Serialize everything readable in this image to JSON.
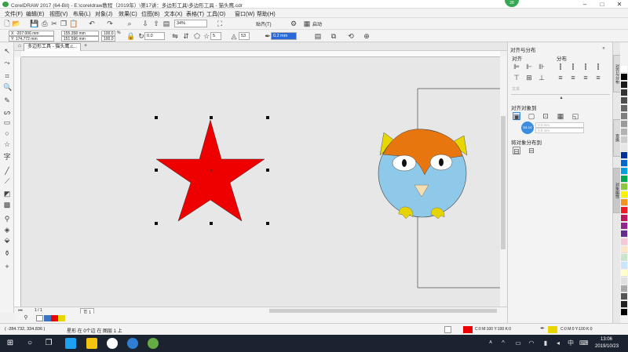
{
  "window": {
    "title": "CorelDRAW 2017 (64-Bit) - E:\\coreldraw教程（2019年）\\第17讲：多边形工具\\多边形工具 - 猫头鹰.cdr",
    "badge": "28"
  },
  "menu": [
    "文件(F)",
    "编辑(E)",
    "视图(V)",
    "布局(L)",
    "对象(J)",
    "效果(C)",
    "位图(B)",
    "文本(X)",
    "表格(T)",
    "工具(O)",
    "窗口(W)",
    "帮助(H)"
  ],
  "toolbar1": {
    "zoom": "34%",
    "snap": "贴齐(T)",
    "launch": "启动"
  },
  "propbar": {
    "x": "X: -207.006 mm",
    "y": "Y: 174.772 mm",
    "w": "155.358 mm",
    "h": "151.596 mm",
    "sx": "100.0",
    "sy": "100.0",
    "pct": "%",
    "angle": "0.0",
    "points": "5",
    "sharp": "53",
    "outline": "0.2 mm"
  },
  "doc_tab": "多边形工具 - 猫头鹰.c...",
  "page_tab": "页 1",
  "page_nav": "1 / 1",
  "status": {
    "coords": "( -284.732, 334.836 )",
    "info": "星形 在 0个边 在 图层 1 上",
    "fill": "C:0 M:100 Y:100 K:0",
    "outline": "C:0 M:0 Y:100 K:0"
  },
  "dock": {
    "title": "对齐与分布",
    "align": "对齐",
    "distribute": "分布",
    "text_label": "文本",
    "align_to": "对齐对象到",
    "dist_to": "将对象分布到",
    "mm1": "0.0 mm",
    "mm2": "0.0 mm",
    "badge_val": "54.14"
  },
  "side_tabs": [
    "对齐与分布",
    "变换",
    "对象属性"
  ],
  "taskbar": {
    "time": "13:06",
    "date": "2019/10/23"
  },
  "palette_colors": [
    "#ffffff",
    "#000000",
    "#1a1a1a",
    "#333333",
    "#4d4d4d",
    "#666666",
    "#808080",
    "#999999",
    "#b3b3b3",
    "#cccccc",
    "#e6e6e6",
    "#003399",
    "#0066cc",
    "#00a0e0",
    "#00a651",
    "#8dc63f",
    "#fff200",
    "#f7941d",
    "#ed1c24",
    "#c2185b",
    "#92278f",
    "#662d91",
    "#f9c8d8",
    "#fde6c8",
    "#c8e6c9",
    "#cce5ff",
    "#ffffcc",
    "#e0e0e0",
    "#aaaaaa",
    "#555555",
    "#222222",
    "#000000"
  ],
  "colors": {
    "star": "#ee0000",
    "owl_body": "#8ec9ea",
    "owl_head": "#e8760e",
    "owl_ear": "#e8d600",
    "owl_feet": "#e6d400",
    "owl_beak": "#f5deb0"
  },
  "icons": [
    "new-icon",
    "open-icon",
    "save-icon",
    "print-icon",
    "undo-icon",
    "redo-icon",
    "import-icon",
    "export-icon",
    "pick-tool-icon",
    "zoom-tool-icon",
    "star-tool-icon",
    "text-tool-icon",
    "fill-tool-icon"
  ]
}
